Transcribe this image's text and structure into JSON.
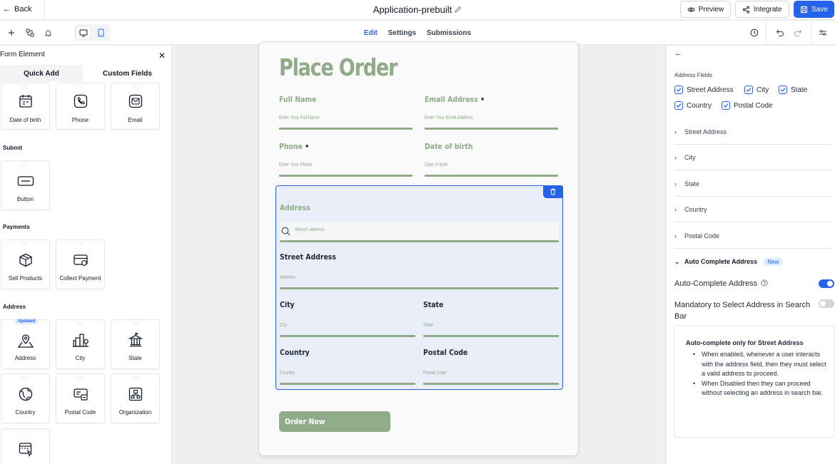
{
  "topbar": {
    "back_label": "Back",
    "title": "Application-prebuilt",
    "preview_label": "Preview",
    "integrate_label": "Integrate",
    "save_label": "Save"
  },
  "toolbar": {
    "tabs": [
      "Edit",
      "Settings",
      "Submissions"
    ],
    "active_tab": "Edit"
  },
  "left_panel": {
    "title": "Form Element",
    "tabs": [
      "Quick Add",
      "Custom Fields"
    ],
    "active_tab": "Custom Fields",
    "top_items": [
      "Date of birth",
      "Phone",
      "Email"
    ],
    "sections": {
      "submit": {
        "title": "Submit",
        "items": [
          "Button"
        ]
      },
      "payments": {
        "title": "Payments",
        "items": [
          "Sell Products",
          "Collect Payment"
        ]
      },
      "address": {
        "title": "Address",
        "badge": "Updated",
        "items": [
          "Address",
          "City",
          "State",
          "Country",
          "Postal Code",
          "Organization"
        ]
      }
    }
  },
  "form": {
    "title": "Place Order",
    "full_name": {
      "label": "Full Name",
      "placeholder": "Enter Your Full Name"
    },
    "email": {
      "label": "Email Address",
      "required_mark": "•",
      "placeholder": "Enter Your Email Address"
    },
    "phone": {
      "label": "Phone",
      "required_mark": "•",
      "placeholder": "Enter Your Phone"
    },
    "dob": {
      "label": "Date of birth",
      "placeholder": "Date of birth"
    },
    "address": {
      "label": "Address",
      "search_placeholder": "Search address",
      "street": {
        "label": "Street Address",
        "placeholder": "Address"
      },
      "city": {
        "label": "City",
        "placeholder": "City"
      },
      "state": {
        "label": "State",
        "placeholder": "State"
      },
      "country": {
        "label": "Country",
        "placeholder": "Country"
      },
      "postal": {
        "label": "Postal Code",
        "placeholder": "Postal Code"
      }
    },
    "submit_label": "Order Now",
    "colors": {
      "accent": "#8fab88",
      "selection": "#2563eb"
    }
  },
  "right_panel": {
    "section_label": "Address Fields",
    "checkboxes": [
      "Street Address",
      "City",
      "State",
      "Country",
      "Postal Code"
    ],
    "accordions": [
      "Street Address",
      "City",
      "State",
      "Country",
      "Postal Code"
    ],
    "auto_section": {
      "label": "Auto Complete Address",
      "badge": "New"
    },
    "auto_complete_label": "Auto-Complete Address",
    "auto_complete_on": true,
    "mandatory_label": "Mandatory to Select Address in Search Bar",
    "mandatory_on": false,
    "info": {
      "title": "Auto-complete only for Street Address",
      "bullets": [
        "When enabled, whenever a user interacts with the address field, then they must select a valid address to proceed.",
        "When Disabled then they can proceed without selecting an address in search bar."
      ]
    }
  }
}
